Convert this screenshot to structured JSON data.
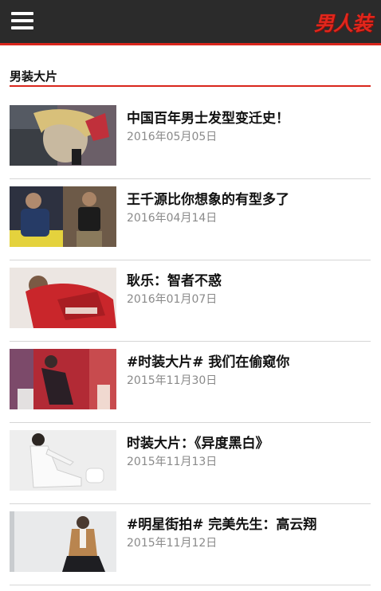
{
  "header": {
    "logo_text": "男人装",
    "menu_icon": "hamburger-menu-icon",
    "accent_color": "#d9261c",
    "bar_color": "#2b2b2b"
  },
  "section": {
    "title": "男装大片"
  },
  "articles": [
    {
      "title": "中国百年男士发型变迁史！",
      "date": "2016年05月05日"
    },
    {
      "title": "王千源比你想象的有型多了",
      "date": "2016年04月14日"
    },
    {
      "title": "耿乐：智者不惑",
      "date": "2016年01月07日"
    },
    {
      "title": "#时装大片# 我们在偷窥你",
      "date": "2015年11月30日"
    },
    {
      "title": "时装大片：《异度黑白》",
      "date": "2015年11月13日"
    },
    {
      "title": "#明星街拍# 完美先生：高云翔",
      "date": "2015年11月12日"
    }
  ]
}
